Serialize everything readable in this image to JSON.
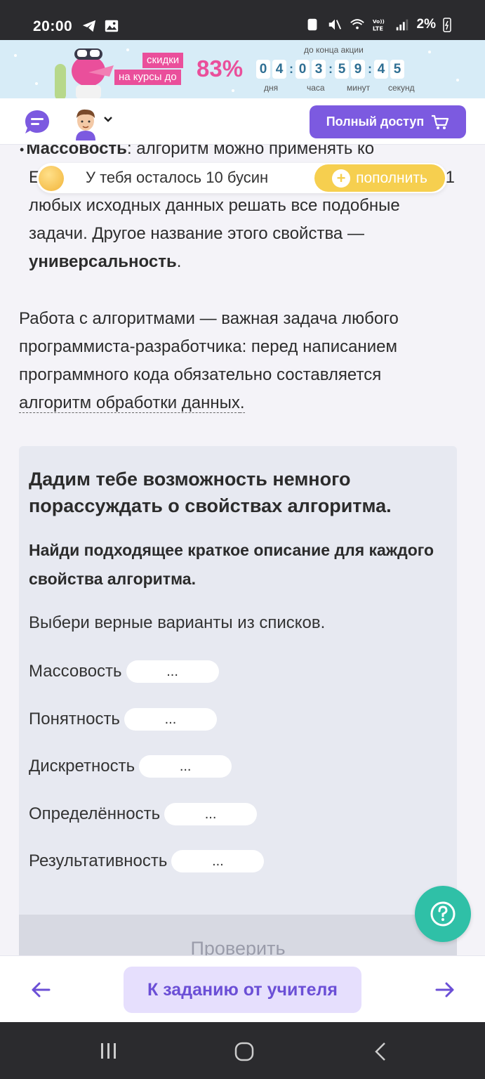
{
  "status_bar": {
    "time": "20:00",
    "battery": "2%"
  },
  "promo": {
    "line1": "скидки",
    "line2": "на курсы до",
    "percent": "83%",
    "timer_title": "до конца акции",
    "digits": [
      "0",
      "4",
      "0",
      "3",
      "5",
      "9",
      "4",
      "5"
    ],
    "labels": [
      "дня",
      "часа",
      "минут",
      "секунд"
    ]
  },
  "header": {
    "full_access_label": "Полный доступ"
  },
  "beads": {
    "text": "У тебя осталось 10 бусин",
    "refill_label": "пополнить"
  },
  "content": {
    "bullet_bold": "Массовость",
    "bullet_rest": ": алгоритм можно применять ко",
    "hidden_line": "Е",
    "hidden_tail": "1",
    "line2": "любых исходных данных решать все подобные",
    "line3": "задачи. Другое название этого свойства —",
    "line4_bold": "универсальность",
    "line4_end": ".",
    "para2_line1": "Работа с алгоритмами — важная задача любого",
    "para2_line2": "программиста-разработчика: перед написанием",
    "para2_line3": "программного кода обязательно составляется",
    "para2_link": "алгоритм обработки данных",
    "para2_end": "."
  },
  "task": {
    "title": "Дадим тебе возможность немного порассуждать о свойствах алгоритма.",
    "instruction": "Найди подходящее краткое описание для каждого свойства алгоритма.",
    "hint": "Выбери верные варианты из списков.",
    "rows": [
      {
        "label": "Массовость",
        "value": "..."
      },
      {
        "label": "Понятность",
        "value": "..."
      },
      {
        "label": "Дискретность",
        "value": "..."
      },
      {
        "label": "Определённость",
        "value": "..."
      },
      {
        "label": "Результативность",
        "value": "..."
      }
    ],
    "check_label": "Проверить"
  },
  "bottom_nav": {
    "teacher_button": "К заданию от учителя"
  },
  "colors": {
    "accent": "#7c5ae0",
    "pink": "#ea4f9b",
    "help": "#2fc0a7",
    "gold": "#f6cf4f"
  }
}
